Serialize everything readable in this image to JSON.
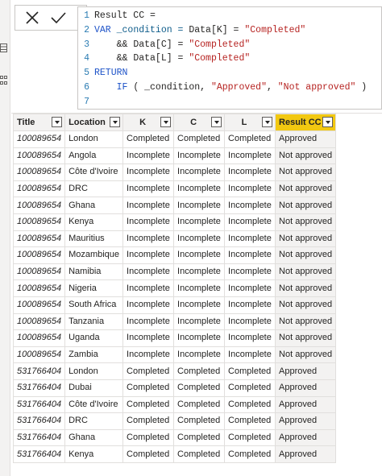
{
  "formula_bar": {
    "cancel_icon": "close-icon",
    "commit_icon": "check-icon",
    "lines": [
      {
        "num": "1",
        "segments": [
          {
            "t": "Result CC =",
            "c": "pl"
          }
        ]
      },
      {
        "num": "2",
        "segments": [
          {
            "t": "VAR",
            "c": "kw"
          },
          {
            "t": " _condition = ",
            "c": "id"
          },
          {
            "t": "Data[K]",
            "c": "pl"
          },
          {
            "t": " = ",
            "c": "pl"
          },
          {
            "t": "\"Completed\"",
            "c": "str"
          }
        ]
      },
      {
        "num": "3",
        "segments": [
          {
            "t": "    && ",
            "c": "pl"
          },
          {
            "t": "Data[C]",
            "c": "pl"
          },
          {
            "t": " = ",
            "c": "pl"
          },
          {
            "t": "\"Completed\"",
            "c": "str"
          }
        ]
      },
      {
        "num": "4",
        "segments": [
          {
            "t": "    && ",
            "c": "pl"
          },
          {
            "t": "Data[L]",
            "c": "pl"
          },
          {
            "t": " = ",
            "c": "pl"
          },
          {
            "t": "\"Completed\"",
            "c": "str"
          }
        ]
      },
      {
        "num": "5",
        "segments": [
          {
            "t": "RETURN",
            "c": "kw"
          }
        ]
      },
      {
        "num": "6",
        "segments": [
          {
            "t": "    IF",
            "c": "kw"
          },
          {
            "t": " ( _condition, ",
            "c": "pl"
          },
          {
            "t": "\"Approved\"",
            "c": "str"
          },
          {
            "t": ", ",
            "c": "pl"
          },
          {
            "t": "\"Not approved\"",
            "c": "str"
          },
          {
            "t": " )",
            "c": "pl"
          }
        ]
      },
      {
        "num": "7",
        "segments": []
      }
    ]
  },
  "table": {
    "columns": [
      "Title",
      "Location",
      "K",
      "C",
      "L",
      "Result CC"
    ],
    "rows": [
      [
        "100089654",
        "London",
        "Completed",
        "Completed",
        "Completed",
        "Approved"
      ],
      [
        "100089654",
        "Angola",
        "Incomplete",
        "Incomplete",
        "Incomplete",
        "Not approved"
      ],
      [
        "100089654",
        "Côte d'Ivoire",
        "Incomplete",
        "Incomplete",
        "Incomplete",
        "Not approved"
      ],
      [
        "100089654",
        "DRC",
        "Incomplete",
        "Incomplete",
        "Incomplete",
        "Not approved"
      ],
      [
        "100089654",
        "Ghana",
        "Incomplete",
        "Incomplete",
        "Incomplete",
        "Not approved"
      ],
      [
        "100089654",
        "Kenya",
        "Incomplete",
        "Incomplete",
        "Incomplete",
        "Not approved"
      ],
      [
        "100089654",
        "Mauritius",
        "Incomplete",
        "Incomplete",
        "Incomplete",
        "Not approved"
      ],
      [
        "100089654",
        "Mozambique",
        "Incomplete",
        "Incomplete",
        "Incomplete",
        "Not approved"
      ],
      [
        "100089654",
        "Namibia",
        "Incomplete",
        "Incomplete",
        "Incomplete",
        "Not approved"
      ],
      [
        "100089654",
        "Nigeria",
        "Incomplete",
        "Incomplete",
        "Incomplete",
        "Not approved"
      ],
      [
        "100089654",
        "South Africa",
        "Incomplete",
        "Incomplete",
        "Incomplete",
        "Not approved"
      ],
      [
        "100089654",
        "Tanzania",
        "Incomplete",
        "Incomplete",
        "Incomplete",
        "Not approved"
      ],
      [
        "100089654",
        "Uganda",
        "Incomplete",
        "Incomplete",
        "Incomplete",
        "Not approved"
      ],
      [
        "100089654",
        "Zambia",
        "Incomplete",
        "Incomplete",
        "Incomplete",
        "Not approved"
      ],
      [
        "531766404",
        "London",
        "Completed",
        "Completed",
        "Completed",
        "Approved"
      ],
      [
        "531766404",
        "Dubai",
        "Completed",
        "Completed",
        "Completed",
        "Approved"
      ],
      [
        "531766404",
        "Côte d'Ivoire",
        "Completed",
        "Completed",
        "Completed",
        "Approved"
      ],
      [
        "531766404",
        "DRC",
        "Completed",
        "Completed",
        "Completed",
        "Approved"
      ],
      [
        "531766404",
        "Ghana",
        "Completed",
        "Completed",
        "Completed",
        "Approved"
      ],
      [
        "531766404",
        "Kenya",
        "Completed",
        "Completed",
        "Completed",
        "Approved"
      ]
    ]
  },
  "colors": {
    "active_header": "#f2c811",
    "keyword": "#1e53c8",
    "string": "#b62321",
    "line_number": "#2b7cb3"
  }
}
